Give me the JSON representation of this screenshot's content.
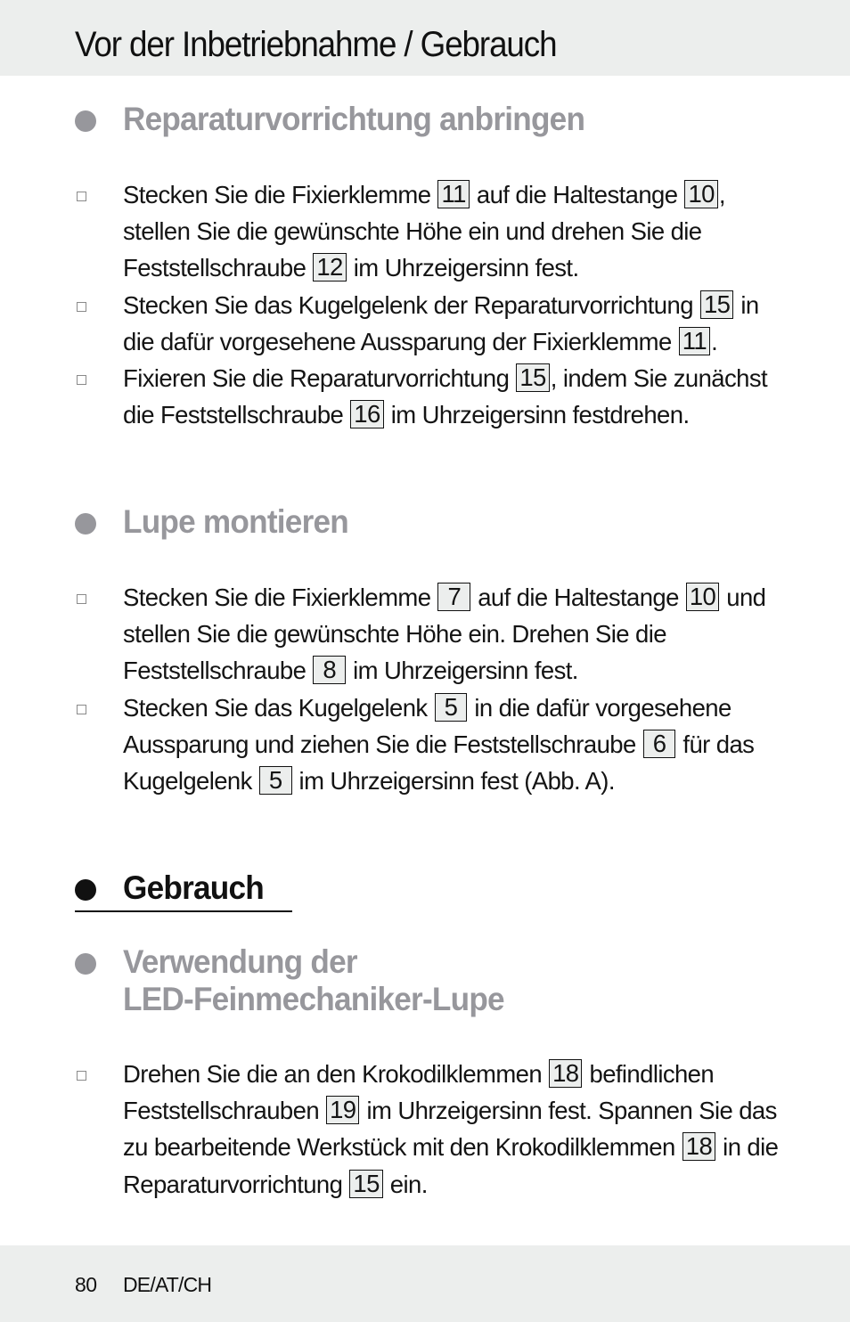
{
  "header": {
    "title": "Vor der Inbetriebnahme / Gebrauch"
  },
  "sections": [
    {
      "heading": "Reparaturvorrichtung anbringen",
      "steps": [
        [
          "Stecken Sie die Fixierklemme ",
          {
            "ref": "11"
          },
          " auf die Haltestange ",
          {
            "ref": "10"
          },
          ", stellen Sie die gewünschte Höhe ein und drehen Sie die Feststellschraube ",
          {
            "ref": "12"
          },
          " im Uhrzeigersinn fest."
        ],
        [
          "Stecken Sie das Kugelgelenk der Reparaturvorrichtung ",
          {
            "ref": "15"
          },
          " in die dafür vorgesehene Aussparung der Fixierklemme ",
          {
            "ref": "11"
          },
          "."
        ],
        [
          "Fixieren Sie die Reparaturvorrichtung ",
          {
            "ref": "15"
          },
          ", indem Sie zu­nächst die Feststellschraube ",
          {
            "ref": "16"
          },
          " im Uhrzeigersinn festdrehen."
        ]
      ]
    },
    {
      "heading": "Lupe montieren",
      "steps": [
        [
          "Stecken Sie die Fixierklemme ",
          {
            "ref": "7"
          },
          " auf die Haltestange ",
          {
            "ref": "10"
          },
          " und stellen Sie die gewünschte Höhe ein. Drehen Sie die Feststellschraube ",
          {
            "ref": "8"
          },
          " im Uhrzeigersinn fest."
        ],
        [
          "Stecken Sie das Kugelgelenk ",
          {
            "ref": "5"
          },
          " in die dafür vorgesehene Aussparung und ziehen Sie die Feststellschraube ",
          {
            "ref": "6"
          },
          " für das Kugelgelenk ",
          {
            "ref": "5"
          },
          " im Uhrzeigersinn fest (Abb. A)."
        ]
      ]
    },
    {
      "heading": "Gebrauch",
      "style": "main"
    },
    {
      "heading_line1": "Verwendung der",
      "heading_line2": "LED-Feinmechaniker-Lupe",
      "steps": [
        [
          "Drehen Sie die an den Krokodilklemmen ",
          {
            "ref": "18"
          },
          " befindlichen Feststellschrauben ",
          {
            "ref": "19"
          },
          " im Uhrzeigersinn fest. Spannen Sie das zu bearbeitende Werkstück mit den Krokodilklemmen ",
          {
            "ref": "18"
          },
          " in die Reparaturvorrichtung ",
          {
            "ref": "15"
          },
          " ein."
        ]
      ]
    }
  ],
  "footer": {
    "page_number": "80",
    "region": "DE/AT/CH"
  },
  "colors": {
    "band": "#eceeed",
    "subheading": "#97979c",
    "text": "#111111"
  }
}
